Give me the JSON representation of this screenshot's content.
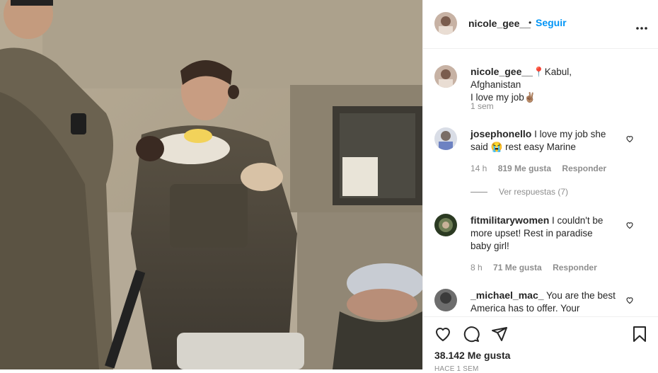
{
  "post": {
    "username": "nicole_gee__",
    "follow_label": "Seguir",
    "separator": "•",
    "caption_user": "nicole_gee__",
    "caption_line1": "📍Kabul, Afghanistan",
    "caption_line2": "I love my job✌🏽",
    "caption_time": "1 sem"
  },
  "comments": [
    {
      "user": "josephonello",
      "text": "I love my job she said 😭 rest easy Marine",
      "time": "14 h",
      "likes": "819 Me gusta",
      "reply": "Responder",
      "view_replies": "Ver respuestas (7)"
    },
    {
      "user": "fitmilitarywomen",
      "text": "I couldn't be more upset! Rest in paradise baby girl!",
      "time": "8 h",
      "likes": "71 Me gusta",
      "reply": "Responder"
    },
    {
      "user": "_michael_mac_",
      "text": "You are the best America has to offer. Your"
    }
  ],
  "footer": {
    "likes": "38.142 Me gusta",
    "date_partial": "HACE 1 SEM"
  },
  "icons": {
    "more": "more-options-icon",
    "like": "heart-icon",
    "comment": "comment-icon",
    "share": "share-icon",
    "save": "bookmark-icon"
  },
  "colors": {
    "accent": "#0095f6",
    "text": "#262626",
    "muted": "#8e8e8e"
  }
}
